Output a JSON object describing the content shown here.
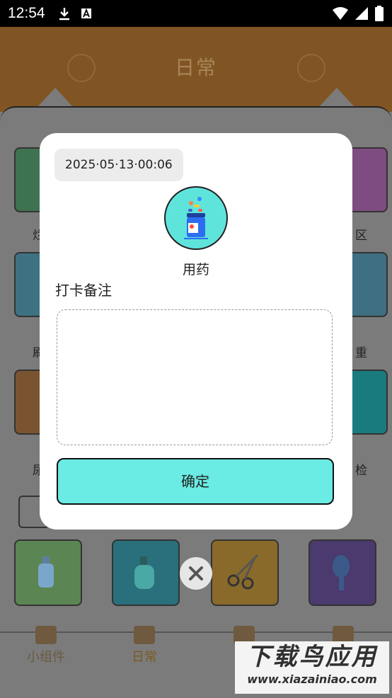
{
  "status_bar": {
    "time": "12:54",
    "left_icons": [
      "download-icon",
      "a-badge-icon"
    ],
    "right_icons": [
      "wifi-icon",
      "signal-icon",
      "battery-icon"
    ]
  },
  "app": {
    "title": "日常",
    "tabs": [
      {
        "label": "小组件",
        "icon": "widget-icon"
      },
      {
        "label": "日常",
        "icon": "calendar-icon",
        "active": true
      },
      {
        "label": "",
        "icon": "home-icon"
      },
      {
        "label": "",
        "icon": "profile-icon"
      }
    ],
    "card_labels": [
      "烂",
      "区",
      "刷",
      "重",
      "尿",
      "检"
    ],
    "bottom_cards": [
      "hand-sanitizer-icon",
      "body-wash-icon",
      "scissors-icon",
      "comb-icon"
    ]
  },
  "modal": {
    "date": "2025·05·13·00:06",
    "item_label": "用药",
    "item_icon": "medicine-bottle-icon",
    "note_label": "打卡备注",
    "note_placeholder": "",
    "confirm_label": "确定"
  },
  "watermark": {
    "title": "下载鸟应用",
    "url": "www.xiazainiao.com"
  },
  "colors": {
    "accent_teal": "#6aebe3",
    "header_brown": "#805523"
  }
}
